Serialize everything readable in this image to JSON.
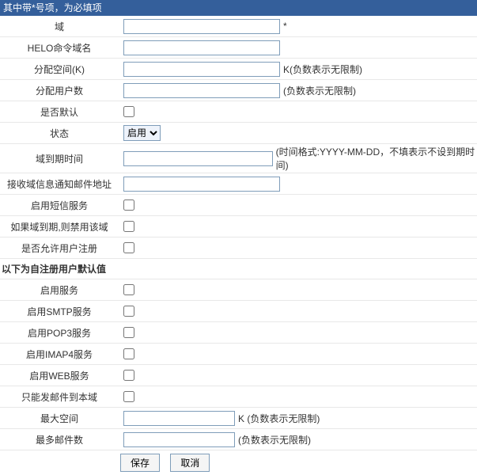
{
  "header": "其中带*号项，为必填项",
  "fields": {
    "domain": {
      "label": "域",
      "star": "*"
    },
    "helo": {
      "label": "HELO命令域名"
    },
    "space": {
      "label": "分配空间(K)",
      "hint": "K(负数表示无限制)"
    },
    "users": {
      "label": "分配用户数",
      "hint": "(负数表示无限制)"
    },
    "isdefault": {
      "label": "是否默认"
    },
    "status": {
      "label": "状态",
      "value": "启用"
    },
    "expire": {
      "label": "域到期时间",
      "hint": "(时间格式:YYYY-MM-DD，不填表示不设到期时间)"
    },
    "notify": {
      "label": "接收域信息通知邮件地址"
    },
    "sms": {
      "label": "启用短信服务"
    },
    "disable": {
      "label": "如果域到期,则禁用该域"
    },
    "allowreg": {
      "label": "是否允许用户注册"
    }
  },
  "section": "以下为自注册用户默认值",
  "reg": {
    "enable": {
      "label": "启用服务"
    },
    "smtp": {
      "label": "启用SMTP服务"
    },
    "pop3": {
      "label": "启用POP3服务"
    },
    "imap4": {
      "label": "启用IMAP4服务"
    },
    "web": {
      "label": "启用WEB服务"
    },
    "localonly": {
      "label": "只能发邮件到本域"
    },
    "maxspace": {
      "label": "最大空间",
      "hint": "K (负数表示无限制)"
    },
    "maxmails": {
      "label": "最多邮件数",
      "hint": "(负数表示无限制)"
    }
  },
  "buttons": {
    "save": "保存",
    "cancel": "取消"
  }
}
